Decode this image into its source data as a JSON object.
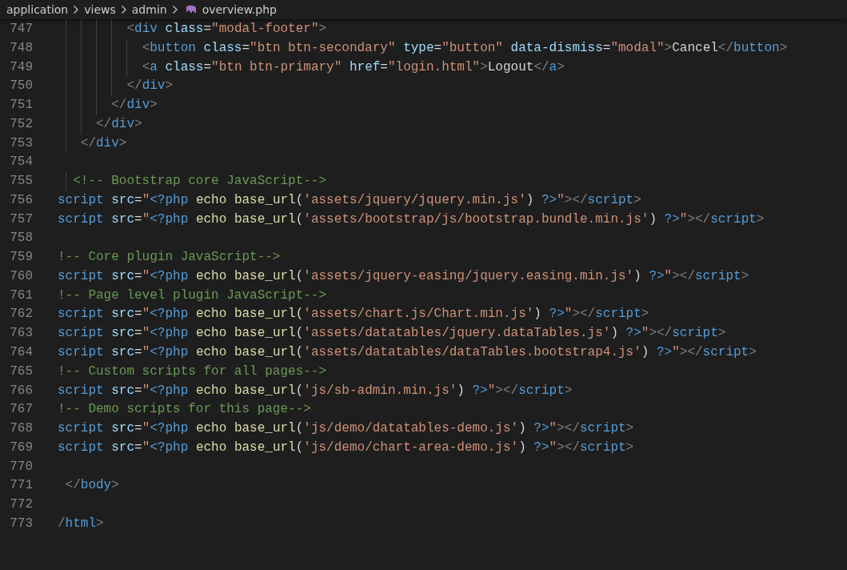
{
  "breadcrumb": [
    {
      "label": "application",
      "kind": "folder"
    },
    {
      "label": "views",
      "kind": "folder"
    },
    {
      "label": "admin",
      "kind": "folder"
    },
    {
      "label": "overview.php",
      "kind": "php-file"
    }
  ],
  "lines": [
    {
      "number": "747",
      "code": "         <div class=\"modal-footer\">"
    },
    {
      "number": "748",
      "code": "           <button class=\"btn btn-secondary\" type=\"button\" data-dismiss=\"modal\">Cancel</button>"
    },
    {
      "number": "749",
      "code": "           <a class=\"btn btn-primary\" href=\"login.html\">Logout</a>"
    },
    {
      "number": "750",
      "code": "         </div>"
    },
    {
      "number": "751",
      "code": "       </div>"
    },
    {
      "number": "752",
      "code": "     </div>"
    },
    {
      "number": "753",
      "code": "   </div>"
    },
    {
      "number": "754"
    },
    {
      "number": "755",
      "code": "  <!-- Bootstrap core JavaScript-->"
    },
    {
      "number": "756",
      "code": "script src=\"<?php echo base_url('assets/jquery/jquery.min.js') ?>\"></script>"
    },
    {
      "number": "757",
      "code": "script src=\"<?php echo base_url('assets/bootstrap/js/bootstrap.bundle.min.js') ?>\"></script>"
    },
    {
      "number": "758"
    },
    {
      "number": "759",
      "code": "!-- Core plugin JavaScript-->"
    },
    {
      "number": "760",
      "code": "script src=\"<?php echo base_url('assets/jquery-easing/jquery.easing.min.js') ?>\"></script>"
    },
    {
      "number": "761",
      "code": "!-- Page level plugin JavaScript-->"
    },
    {
      "number": "762",
      "code": "script src=\"<?php echo base_url('assets/chart.js/Chart.min.js') ?>\"></script>"
    },
    {
      "number": "763",
      "code": "script src=\"<?php echo base_url('assets/datatables/jquery.dataTables.js') ?>\"></script>"
    },
    {
      "number": "764",
      "code": "script src=\"<?php echo base_url('assets/datatables/dataTables.bootstrap4.js') ?>\"></script>"
    },
    {
      "number": "765",
      "code": "!-- Custom scripts for all pages-->"
    },
    {
      "number": "766",
      "code": "script src=\"<?php echo base_url('js/sb-admin.min.js') ?>\"></script>"
    },
    {
      "number": "767",
      "code": "!-- Demo scripts for this page-->"
    },
    {
      "number": "768",
      "code": "script src=\"<?php echo base_url('js/demo/datatables-demo.js') ?>\"></script>"
    },
    {
      "number": "769",
      "code": "script src=\"<?php echo base_url('js/demo/chart-area-demo.js') ?>\"></script>"
    },
    {
      "number": "770"
    },
    {
      "number": "771",
      "code": " </body>"
    },
    {
      "number": "772"
    },
    {
      "number": "773",
      "code": "/html>"
    }
  ]
}
